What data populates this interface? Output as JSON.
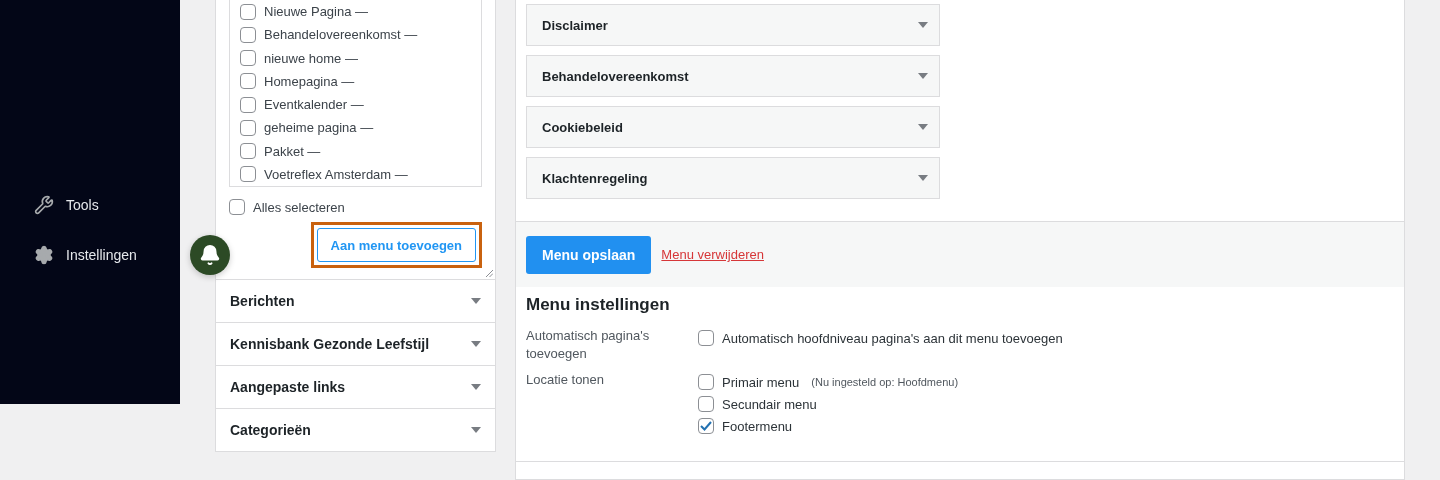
{
  "sidebar": {
    "items": [
      {
        "kind": "tools",
        "label": "Tools"
      },
      {
        "kind": "settings",
        "label": "Instellingen"
      }
    ]
  },
  "pages_box": {
    "items": [
      {
        "label": "Nieuwe Pagina —",
        "checked": false
      },
      {
        "label": "Behandelovereenkomst —",
        "checked": false
      },
      {
        "label": "nieuwe home —",
        "checked": false
      },
      {
        "label": "Homepagina —",
        "checked": false
      },
      {
        "label": "Eventkalender —",
        "checked": false
      },
      {
        "label": "geheime pagina —",
        "checked": false
      },
      {
        "label": "Pakket —",
        "checked": false
      },
      {
        "label": "Voetreflex Amsterdam —",
        "checked": false
      }
    ],
    "select_all": {
      "label": "Alles selecteren",
      "checked": false
    },
    "add_button": {
      "label": "Aan menu toevoegen",
      "highlighted": true
    }
  },
  "sections": [
    {
      "label": "Berichten",
      "expanded": false
    },
    {
      "label": "Kennisbank Gezonde Leefstijl",
      "expanded": false
    },
    {
      "label": "Aangepaste links",
      "expanded": false
    },
    {
      "label": "Categorieën",
      "expanded": false
    }
  ],
  "menu_items": [
    {
      "label": "Disclaimer",
      "expanded": false
    },
    {
      "label": "Behandelovereenkomst",
      "expanded": false
    },
    {
      "label": "Cookiebeleid",
      "expanded": false
    },
    {
      "label": "Klachtenregeling",
      "expanded": false
    }
  ],
  "footer": {
    "save_button": "Menu opslaan",
    "delete_link": "Menu verwijderen"
  },
  "settings": {
    "title": "Menu instellingen",
    "rows": [
      {
        "label": "Automatisch pagina's toevoegen",
        "options": [
          {
            "label": "Automatisch hoofdniveau pagina's aan dit menu toevoegen",
            "checked": false
          }
        ]
      },
      {
        "label": "Locatie tonen",
        "options": [
          {
            "label": "Primair menu",
            "note": "(Nu ingesteld op: Hoofdmenu)",
            "checked": false
          },
          {
            "label": "Secundair menu",
            "checked": false
          },
          {
            "label": "Footermenu",
            "checked": true
          }
        ]
      }
    ]
  }
}
